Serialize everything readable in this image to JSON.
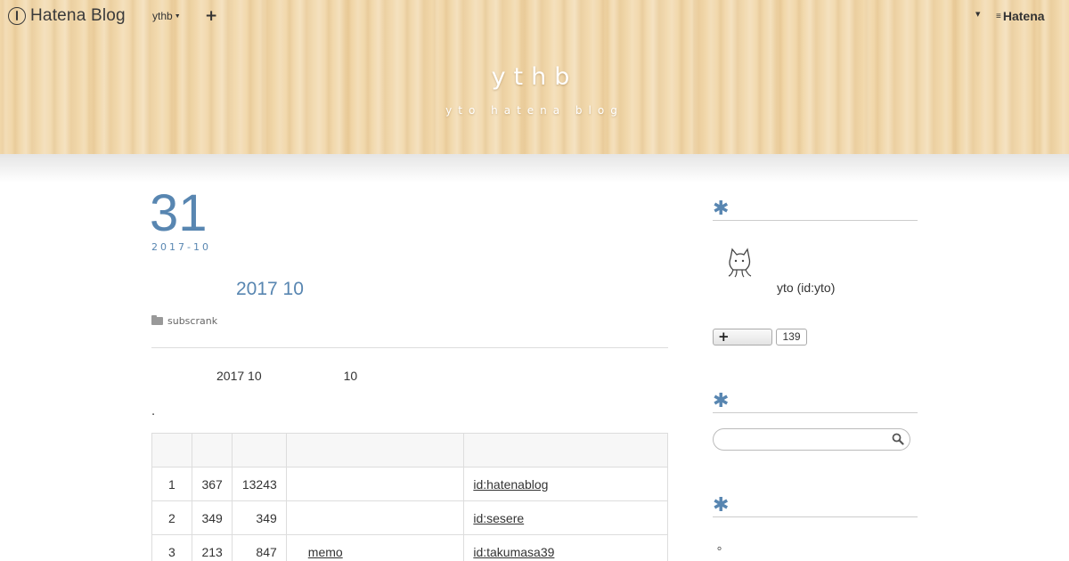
{
  "topbar": {
    "logo_text": "Hatena Blog",
    "blog_menu_label": "ythb",
    "plus_label": "+",
    "hatena_label": "Hatena"
  },
  "header": {
    "title": "ythb",
    "description": "yto hatena blog"
  },
  "entry": {
    "day": "31",
    "yearmonth": "2017-10",
    "title": "2017 10",
    "category": "subscrank",
    "intro_a": "2017 10",
    "intro_b": "10",
    "dot": "."
  },
  "table": {
    "rows": [
      {
        "rank": "1",
        "a": "367",
        "b": "13243",
        "name": "",
        "id": "id:hatenablog"
      },
      {
        "rank": "2",
        "a": "349",
        "b": "349",
        "name": "",
        "id": "id:sesere"
      },
      {
        "rank": "3",
        "a": "213",
        "b": "847",
        "name": "memo",
        "id": "id:takumasa39"
      }
    ]
  },
  "sidebar": {
    "profile_name": "yto (id:yto)",
    "follow_plus": "+",
    "follow_count": "139",
    "search_placeholder": "",
    "bottom_text": "。"
  },
  "colors": {
    "accent": "#5886b1",
    "header_wood": "#f1d7a9"
  },
  "icons": [
    "hatena-blog-logo-icon",
    "chevron-down-icon",
    "plus-icon",
    "hatena-logo-icon",
    "folder-icon",
    "asterisk-icon",
    "avatar-icon",
    "search-icon"
  ]
}
